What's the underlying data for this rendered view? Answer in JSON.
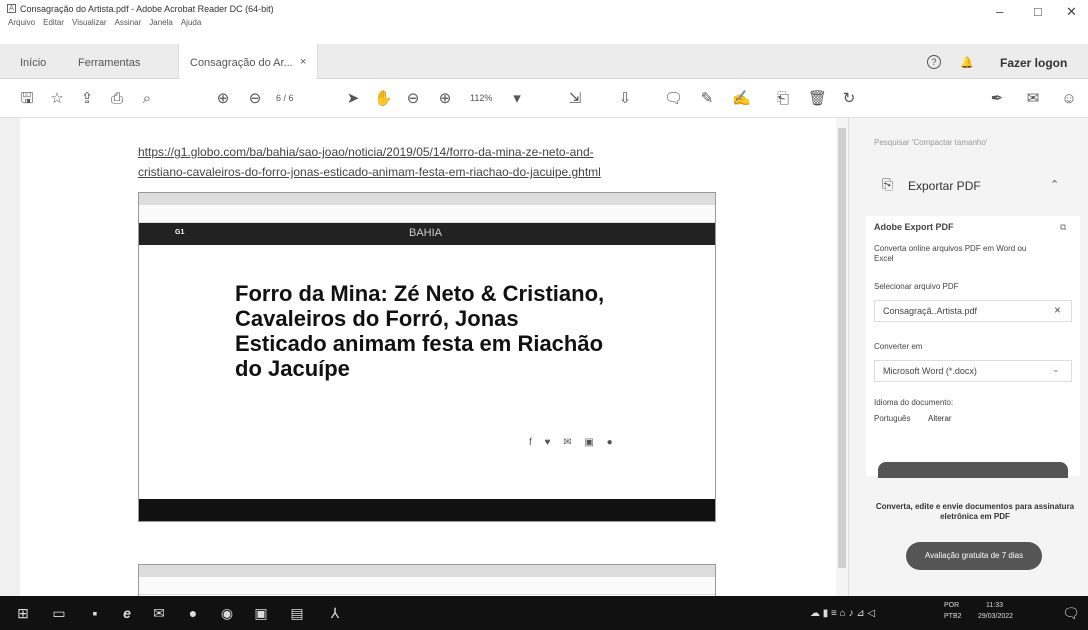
{
  "window": {
    "title": "Consagração do Artista.pdf - Adobe Acrobat Reader DC (64-bit)",
    "menu": [
      "Arquivo",
      "Editar",
      "Visualizar",
      "Assinar",
      "Janela",
      "Ajuda"
    ],
    "controls": [
      "–",
      "□",
      "✕"
    ]
  },
  "tabs": {
    "home": "Início",
    "tools": "Ferramentas",
    "doc": "Consagração do Ar...",
    "doc_close": "×",
    "login": "Fazer logon"
  },
  "toolbar": {
    "page_current": "6",
    "page_total": "/ 6",
    "zoom": "112%"
  },
  "document": {
    "link_line1": "https://g1.globo.com/ba/bahia/sao-joao/noticia/2019/05/14/forro-da-mina-ze-neto-and-",
    "link_line2": "cristiano-cavaleiros-do-forro-jonas-esticado-animam-festa-em-riachao-do-jacuipe.ghtml",
    "screenshot": {
      "section": "BAHIA",
      "logo": "G1",
      "headline": "Forro da Mina: Zé Neto & Cristiano, Cavaleiros do Forró, Jonas Esticado animam festa em Riachão do Jacuípe"
    }
  },
  "panel": {
    "search_placeholder": "Pesquisar 'Compactar tamanho'",
    "export_title": "Exportar PDF",
    "adobe_export": "Adobe Export PDF",
    "description": "Converta online arquivos PDF em Word ou Excel",
    "select_label": "Selecionar arquivo PDF",
    "file_name": "Consagraçã..Artista.pdf",
    "convert_label": "Converter em",
    "convert_value": "Microsoft Word (*.docx)",
    "lang_label": "Idioma do documento:",
    "lang_value": "Português",
    "lang_change": "Alterar",
    "promo": "Converta, edite e envie documentos para assinatura eletrônica em PDF",
    "trial": "Avaliação gratuita de 7 dias"
  },
  "taskbar": {
    "lang": "POR",
    "lang2": "PTB2",
    "time": "11:33",
    "date": "29/03/2022"
  }
}
